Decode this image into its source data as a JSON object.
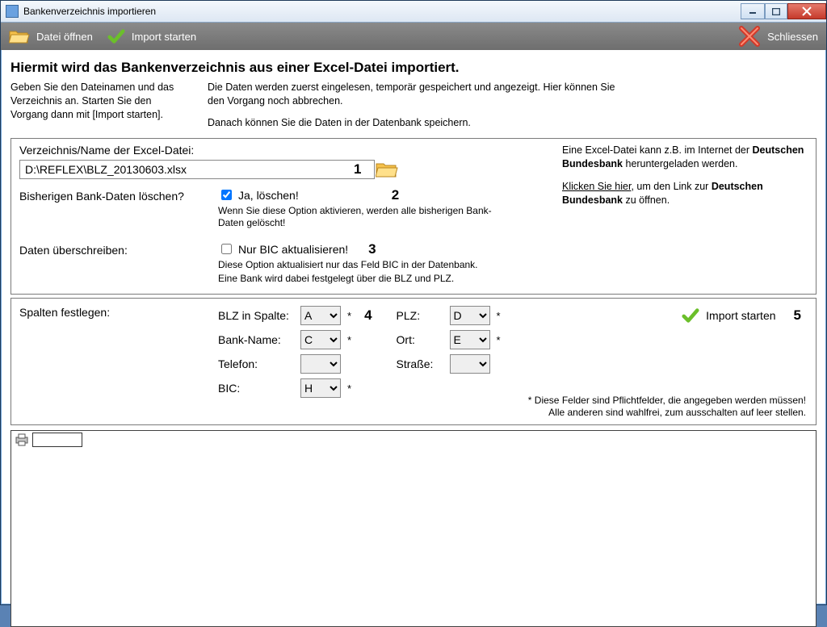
{
  "window": {
    "title": "Bankenverzeichnis importieren"
  },
  "toolbar": {
    "open_label": "Datei öffnen",
    "start_label": "Import starten",
    "close_label": "Schliessen"
  },
  "intro": {
    "heading": "Hiermit wird das Bankenverzeichnis  aus einer Excel-Datei importiert.",
    "left": "Geben Sie den Dateinamen und das Verzeichnis an. Starten Sie den Vorgang dann mit [Import starten].",
    "right1": "Die Daten werden zuerst eingelesen, temporär gespeichert und angezeigt. Hier können Sie den Vorgang noch abbrechen.",
    "right2": "Danach können Sie die Daten in der Datenbank speichern."
  },
  "file": {
    "label": "Verzeichnis/Name der Excel-Datei:",
    "path": "D:\\REFLEX\\BLZ_20130603.xlsx",
    "badge1": "1",
    "badge2": "2"
  },
  "delete": {
    "label": "Bisherigen Bank-Daten löschen?",
    "cb_label": "Ja, löschen!",
    "checked": true,
    "hint": "Wenn Sie diese Option aktivieren, werden alle bisherigen Bank-Daten gelöscht!"
  },
  "overwrite": {
    "label": "Daten überschreiben:",
    "cb_label": "Nur BIC aktualisieren!",
    "checked": false,
    "badge3": "3",
    "hint1": "Diese Option aktualisiert nur das Feld BIC in der Datenbank.",
    "hint2": "Eine Bank wird dabei festgelegt über die BLZ und PLZ."
  },
  "side": {
    "line1a": "Eine Excel-Datei kann z.B. im Internet der ",
    "line1b": "Deutschen Bundesbank",
    "line1c": " heruntergeladen werden.",
    "link": "Klicken Sie hier",
    "line2a": ", um den Link zur ",
    "line2b": "Deutschen Bundesbank",
    "line2c": " zu öffnen."
  },
  "cols": {
    "label": "Spalten festlegen:",
    "blz_label": "BLZ in Spalte:",
    "blz": "A",
    "bank_label": "Bank-Name:",
    "bank": "C",
    "tel_label": "Telefon:",
    "tel": "",
    "bic_label": "BIC:",
    "bic": "H",
    "plz_label": "PLZ:",
    "plz": "D",
    "ort_label": "Ort:",
    "ort": "E",
    "str_label": "Straße:",
    "str": "",
    "badge4": "4",
    "import_label": "Import starten",
    "badge5": "5",
    "req1": "* Diese Felder sind Pflichtfelder, die angegeben werden müssen!",
    "req2": "Alle anderen sind wahlfrei, zum ausschalten auf leer stellen."
  }
}
